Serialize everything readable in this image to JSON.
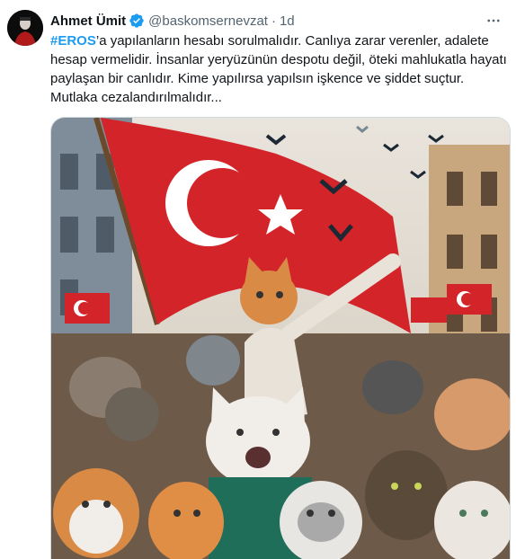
{
  "tweet": {
    "author_name": "Ahmet Ümit",
    "handle": "@baskomsernevzat",
    "separator": "·",
    "time": "1d",
    "hashtag": "#EROS",
    "body_rest": "’a yapılanların hesabı sorulmalıdır.  Canlıya zarar verenler, adalete hesap vermelidir. İnsanlar yeryüzünün despotu değil, öteki mahlukatla hayatı paylaşan bir canlıdır. Kime yapılırsa yapılsın işkence ve şiddet suçtur. Mutlaka cezalandırılmalıdır...",
    "verified_color": "#1d9bf0",
    "hashtag_color": "#1d9bf0",
    "media_alt_icon": "cats-protest-illustration"
  }
}
